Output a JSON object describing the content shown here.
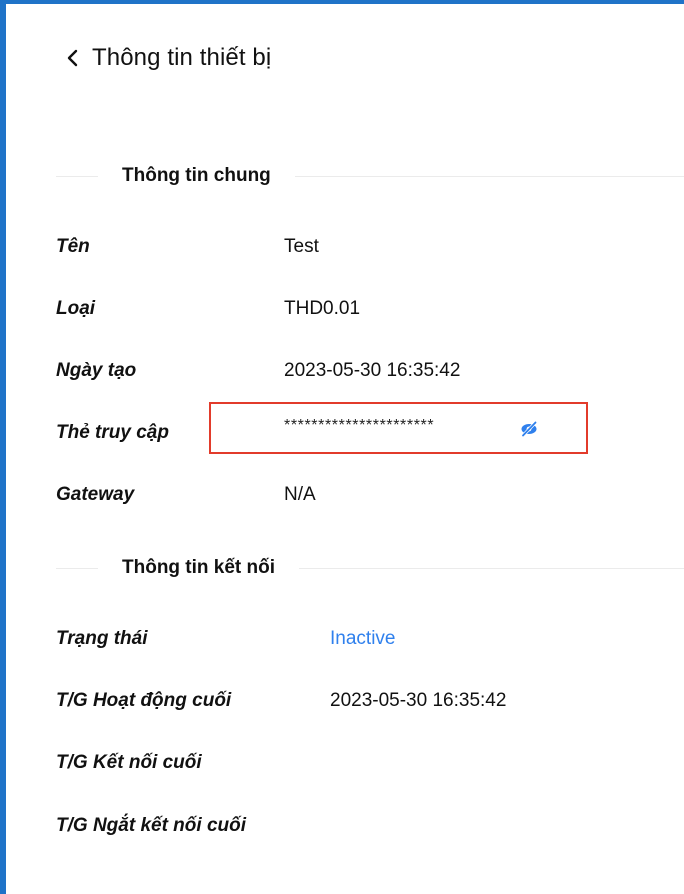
{
  "header": {
    "title": "Thông tin thiết bị"
  },
  "general": {
    "section_title": "Thông tin chung",
    "name_label": "Tên",
    "name_value": "Test",
    "type_label": "Loại",
    "type_value": "THD0.01",
    "created_label": "Ngày tạo",
    "created_value": "2023-05-30 16:35:42",
    "token_label": "Thẻ truy cập",
    "token_value": "**********************",
    "gateway_label": "Gateway",
    "gateway_value": "N/A"
  },
  "connection": {
    "section_title": "Thông tin kết nối",
    "status_label": "Trạng thái",
    "status_value": "Inactive",
    "last_active_label": "T/G Hoạt động cuối",
    "last_active_value": "2023-05-30 16:35:42",
    "last_connect_label": "T/G Kết nối cuối",
    "last_disconnect_label": "T/G Ngắt kết nối cuối"
  },
  "colors": {
    "accent": "#2f80ed",
    "frame": "#1f73c8",
    "highlight": "#e23b2b"
  },
  "icons": {
    "back": "chevron-left-icon",
    "token_visibility": "eye-off-icon"
  }
}
